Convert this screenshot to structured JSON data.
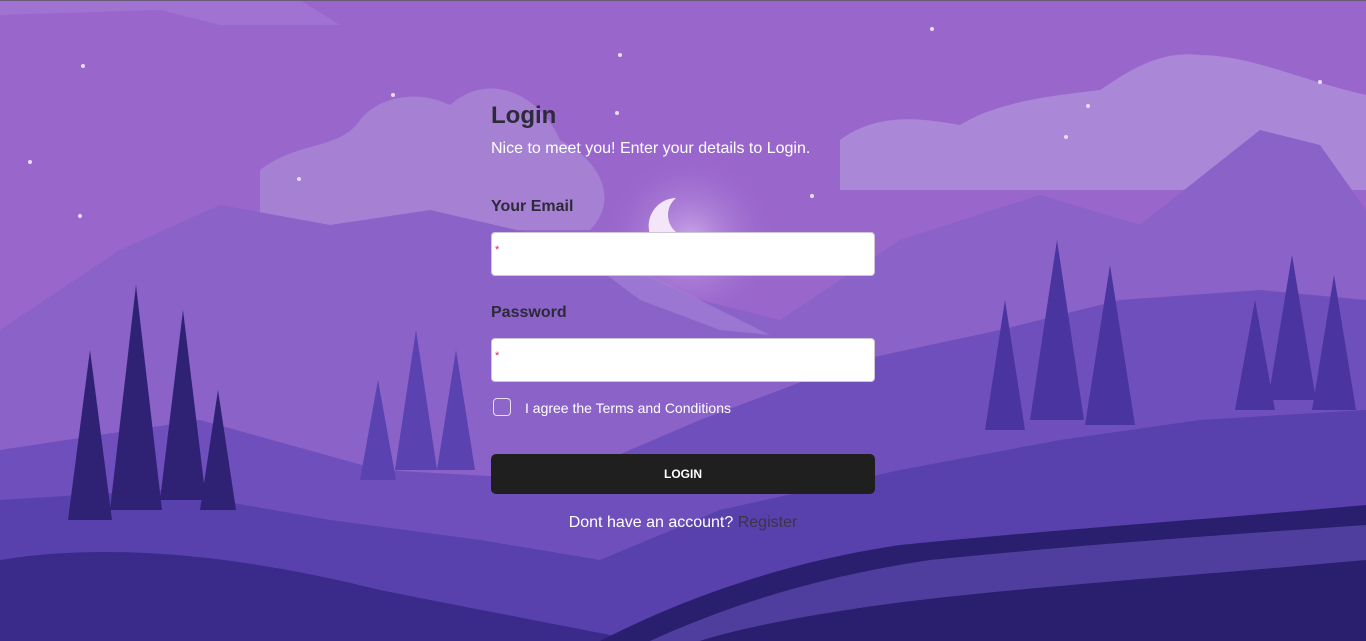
{
  "login": {
    "title": "Login",
    "subtitle": "Nice to meet you! Enter your details to Login.",
    "email_label": "Your Email",
    "email_value": "",
    "password_label": "Password",
    "password_value": "",
    "required_marker": "*",
    "terms_checked": false,
    "terms_label": "I agree the Terms and Conditions",
    "submit_label": "LOGIN",
    "footer_text": "Dont have an account?",
    "register_link": "Register"
  },
  "colors": {
    "sky": "#9966cc",
    "button": "#1f1f1f",
    "required": "#e0245e",
    "heading": "#2d2a3a"
  },
  "icons": [
    "crescent-moon",
    "star",
    "pine-tree",
    "mountain"
  ]
}
